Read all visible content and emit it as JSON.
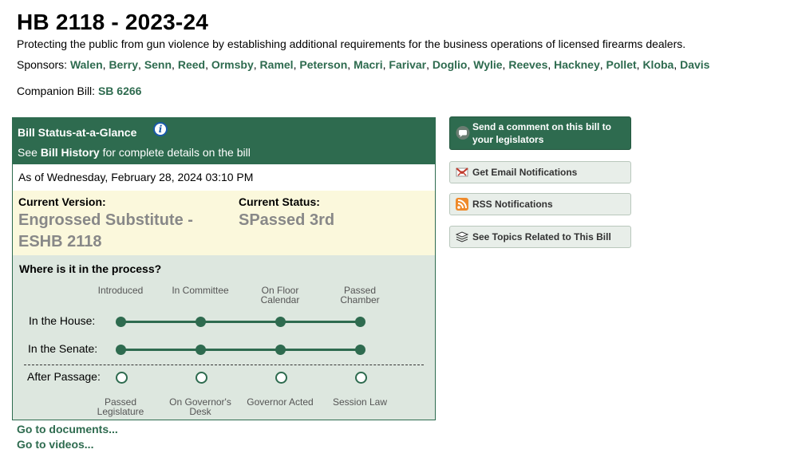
{
  "bill": {
    "title": "HB 2118 - 2023-24",
    "description": "Protecting the public from gun violence by establishing additional requirements for the business operations of licensed firearms dealers.",
    "sponsors_label": "Sponsors:",
    "sponsors": [
      "Walen",
      "Berry",
      "Senn",
      "Reed",
      "Ormsby",
      "Ramel",
      "Peterson",
      "Macri",
      "Farivar",
      "Doglio",
      "Wylie",
      "Reeves",
      "Hackney",
      "Pollet",
      "Kloba",
      "Davis"
    ],
    "companion_label": "Companion Bill:",
    "companion_bill": "SB 6266"
  },
  "status": {
    "heading": "Bill Status-at-a-Glance",
    "info_icon": "info-icon",
    "see_prefix": "See",
    "history_link": "Bill History",
    "see_suffix": "for complete details on the bill",
    "as_of": "As of Wednesday, February 28, 2024 03:10 PM",
    "current_version_label": "Current Version:",
    "current_version_value": "Engrossed Substitute - ESHB 2118",
    "current_status_label": "Current Status:",
    "current_status_value": "SPassed 3rd",
    "process_heading": "Where is it in the process?",
    "stages_top": [
      "Introduced",
      "In Committee",
      "On Floor Calendar",
      "Passed Chamber"
    ],
    "house_label": "In the House:",
    "senate_label": "In the Senate:",
    "after_label": "After Passage:",
    "stages_bottom": [
      "Passed Legislature",
      "On Governor's Desk",
      "Governor Acted",
      "Session Law"
    ],
    "house_progress": [
      true,
      true,
      true,
      true
    ],
    "senate_progress": [
      true,
      true,
      true,
      true
    ],
    "after_progress": [
      false,
      false,
      false,
      false
    ]
  },
  "actions": {
    "comment": "Send a comment on this bill to your legislators",
    "email": "Get Email Notifications",
    "rss": "RSS Notifications",
    "topics": "See Topics Related to This Bill"
  },
  "links": {
    "documents": "Go to documents...",
    "videos": "Go to videos..."
  },
  "colors": {
    "brand_green": "#2e6b4f",
    "status_yellow": "#fbf8dc",
    "panel_green": "#dde7df"
  }
}
